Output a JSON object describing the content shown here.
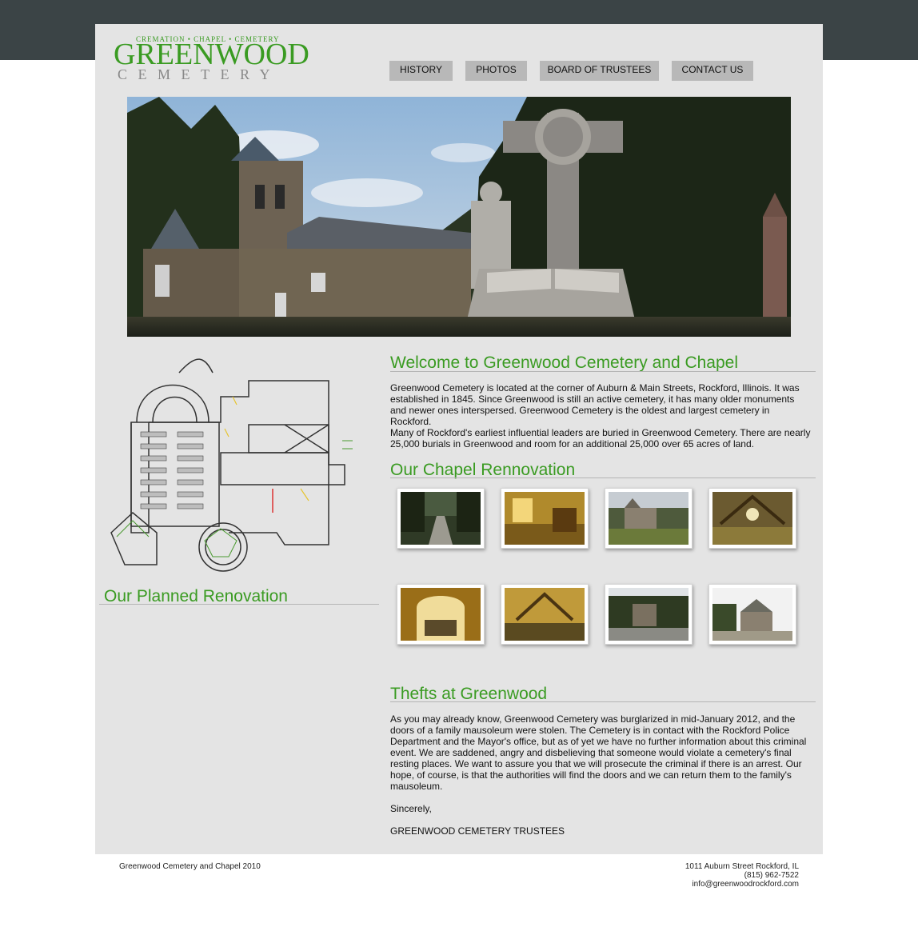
{
  "logo": {
    "tagline": "CREMATION • CHAPEL • CEMETERY",
    "name": "GREENWOOD",
    "subname": "CEMETERY",
    "brand_color": "#3a9b22"
  },
  "nav": {
    "items": [
      {
        "label": "HISTORY"
      },
      {
        "label": "PHOTOS"
      },
      {
        "label": "BOARD OF TRUSTEES"
      },
      {
        "label": "CONTACT US"
      }
    ]
  },
  "welcome": {
    "heading": "Welcome to Greenwood Cemetery and Chapel",
    "paragraph1": "Greenwood Cemetery is located at the corner of Auburn & Main Streets, Rockford, Illinois. It was established in 1845. Since Greenwood is still an active cemetery, it has many older monuments and newer ones interspersed. Greenwood Cemetery is the oldest and largest cemetery in Rockford.",
    "paragraph2": "Many of Rockford's earliest influential leaders are buried in Greenwood Cemetery. There are nearly 25,000 burials in Greenwood and room for an additional 25,000 over 65 acres of land."
  },
  "chapel": {
    "heading": "Our Chapel Rennovation"
  },
  "planned": {
    "heading": "Our Planned Renovation"
  },
  "thefts": {
    "heading": "Thefts at Greenwood",
    "paragraph": "As you may already know, Greenwood Cemetery was burglarized in mid-January 2012, and the doors of a family mausoleum were stolen. The Cemetery is in contact with the Rockford Police Department and the Mayor's office, but as of yet we have no further information about this criminal event. We are saddened, angry and disbelieving that someone would violate a cemetery's final resting places. We want to assure you that we will prosecute the criminal if there is an arrest. Our hope, of course, is that the authorities will find the doors and we can return them to the family's mausoleum.",
    "closing": "Sincerely,",
    "signature": "GREENWOOD CEMETERY TRUSTEES"
  },
  "footer": {
    "copyright": "Greenwood Cemetery and Chapel 2010",
    "address": "1011 Auburn Street Rockford, IL",
    "phone": "(815) 962-7522",
    "email": "info@greenwoodrockford.com"
  }
}
